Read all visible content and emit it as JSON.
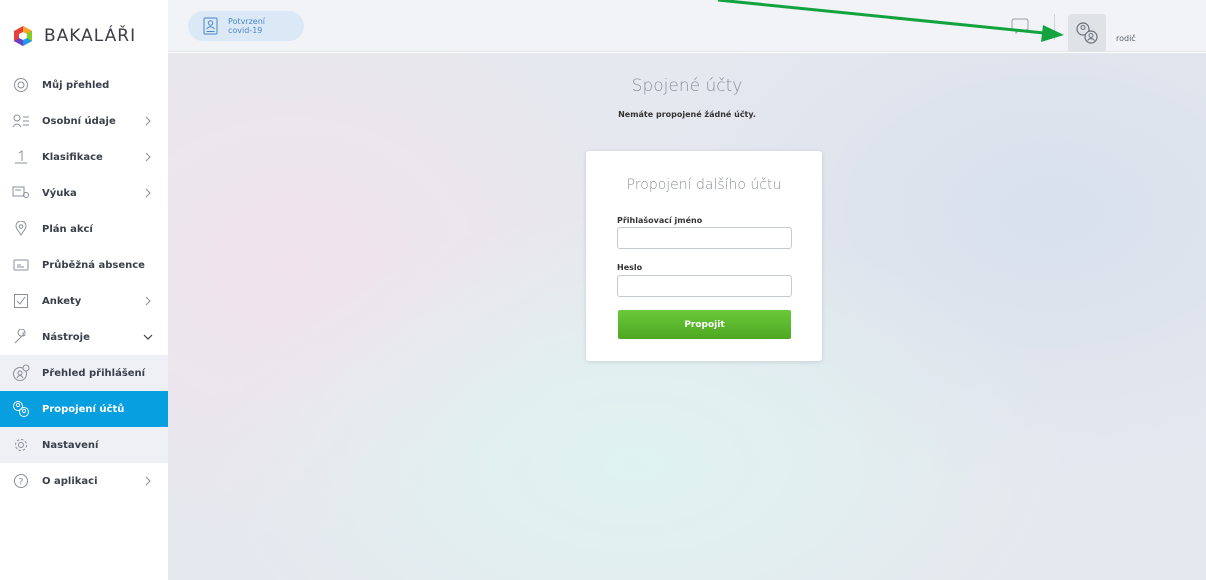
{
  "app": {
    "logo_text": "BAKALÁŘI"
  },
  "sidebar": {
    "items": [
      {
        "label": "Můj přehled"
      },
      {
        "label": "Osobní údaje"
      },
      {
        "label": "Klasifikace"
      },
      {
        "label": "Výuka"
      },
      {
        "label": "Plán akcí"
      },
      {
        "label": "Průběžná absence"
      },
      {
        "label": "Ankety"
      },
      {
        "label": "Nástroje"
      },
      {
        "label": "Přehled přihlášení"
      },
      {
        "label": "Propojení účtů"
      },
      {
        "label": "Nastavení"
      },
      {
        "label": "O aplikaci"
      }
    ],
    "active_item": "Propojení účtů"
  },
  "topbar": {
    "covid_line1": "Potvrzení",
    "covid_line2": "covid-19",
    "user_role": "rodič"
  },
  "main": {
    "title": "Spojené účty",
    "subtitle": "Nemáte propojené žádné účty.",
    "form": {
      "title": "Propojení dalšího účtu",
      "username_label": "Přihlašovací jméno",
      "username_value": "",
      "password_label": "Heslo",
      "password_value": "",
      "submit_label": "Propojit"
    }
  },
  "colors": {
    "accent": "#079fe0",
    "button_green": "#5ab82b",
    "annotation_arrow": "#12a33f"
  }
}
